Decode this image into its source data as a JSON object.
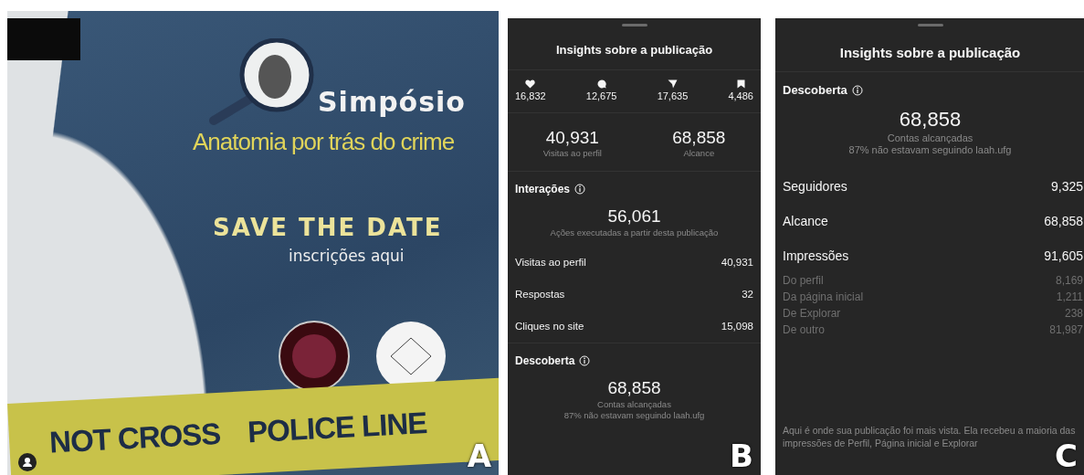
{
  "poster": {
    "title": "Simpósio",
    "subtitle": "Anatomia por trás do crime",
    "save_the_date": "SAVE THE DATE",
    "registration": "inscrições aqui",
    "tape_texts": [
      "NOT CROSS",
      "POLICE LINE"
    ],
    "label": "A"
  },
  "panel_b": {
    "title": "Insights sobre a publicação",
    "stats": [
      {
        "kind": "like",
        "value": "16,832"
      },
      {
        "kind": "comment",
        "value": "12,675"
      },
      {
        "kind": "share",
        "value": "17,635"
      },
      {
        "kind": "save",
        "value": "4,486"
      }
    ],
    "summary": [
      {
        "value": "40,931",
        "label": "Visitas ao perfil"
      },
      {
        "value": "68,858",
        "label": "Alcance"
      }
    ],
    "interactions": {
      "heading": "Interações",
      "total": "56,061",
      "caption": "Ações executadas a partir desta publicação",
      "rows": [
        {
          "label": "Visitas ao perfil",
          "value": "40,931"
        },
        {
          "label": "Respostas",
          "value": "32"
        },
        {
          "label": "Cliques no site",
          "value": "15,098"
        }
      ]
    },
    "discovery": {
      "heading": "Descoberta",
      "total": "68,858",
      "caption": "Contas alcançadas",
      "note": "87% não estavam seguindo laah.ufg"
    },
    "label": "B"
  },
  "panel_c": {
    "title": "Insights sobre a publicação",
    "discovery": {
      "heading": "Descoberta",
      "total": "68,858",
      "caption": "Contas alcançadas",
      "note": "87% não estavam seguindo laah.ufg"
    },
    "rows": [
      {
        "kind": "main",
        "label": "Seguidores",
        "value": "9,325"
      },
      {
        "kind": "main",
        "label": "Alcance",
        "value": "68,858"
      },
      {
        "kind": "main",
        "label": "Impressões",
        "value": "91,605"
      },
      {
        "kind": "sub",
        "label": "Do perfil",
        "value": "8,169"
      },
      {
        "kind": "sub",
        "label": "Da página inicial",
        "value": "1,211"
      },
      {
        "kind": "sub",
        "label": "De Explorar",
        "value": "238"
      },
      {
        "kind": "sub",
        "label": "De outro",
        "value": "81,987"
      }
    ],
    "footer": "Aqui é onde sua publicação foi mais vista. Ela recebeu a maioria das impressões de Perfil, Página inicial e Explorar",
    "label": "C"
  }
}
